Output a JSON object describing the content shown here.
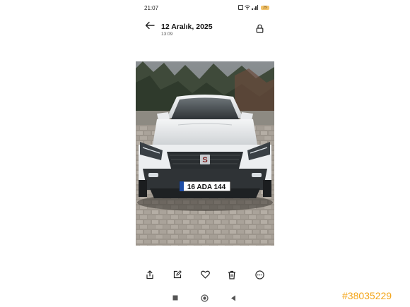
{
  "status_bar": {
    "time": "21:07",
    "battery_level": "29"
  },
  "header": {
    "title": "12 Aralık, 2025",
    "subtitle": "13:09"
  },
  "photo": {
    "plate_text": "16 ADA 144",
    "brand_mark": "S"
  },
  "actions": [
    {
      "icon": "share-icon"
    },
    {
      "icon": "edit-icon"
    },
    {
      "icon": "heart-icon"
    },
    {
      "icon": "trash-icon"
    },
    {
      "icon": "more-icon"
    }
  ],
  "navigation": [
    {
      "icon": "recents-square-icon"
    },
    {
      "icon": "home-circle-icon"
    },
    {
      "icon": "back-triangle-icon"
    }
  ],
  "watermark": "#38035229",
  "colors": {
    "accent_watermark": "#f3a51a",
    "battery": "#f2c36b"
  }
}
